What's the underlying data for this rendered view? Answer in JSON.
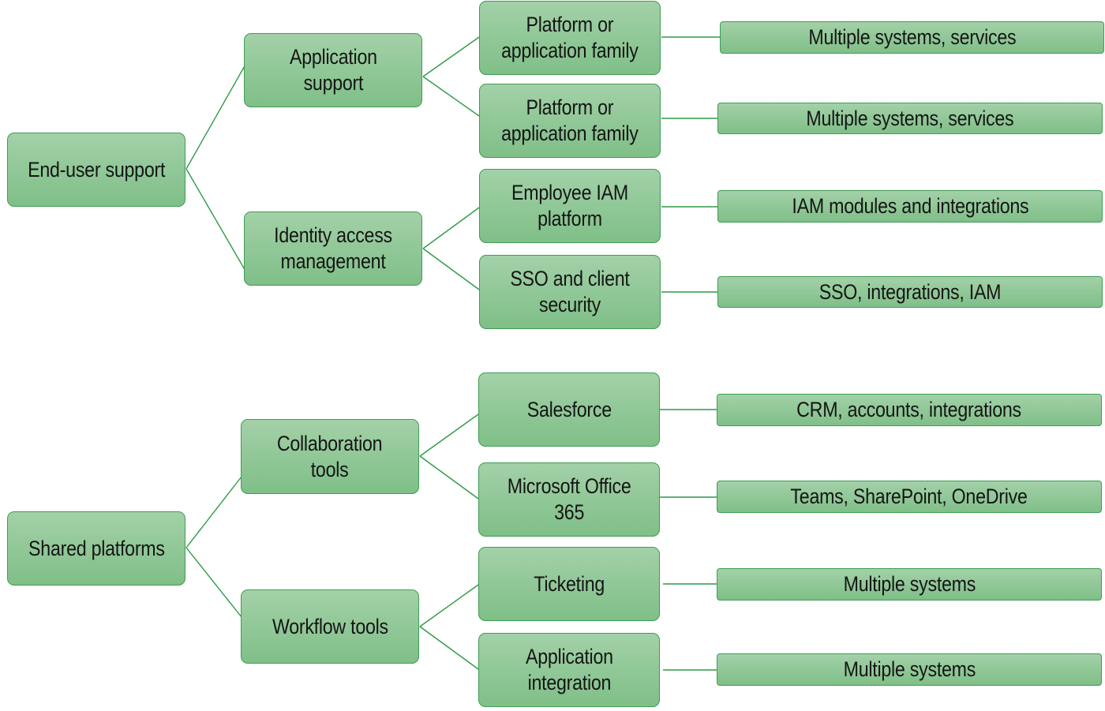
{
  "diagram": {
    "type": "tree",
    "colors": {
      "node_fill": "#93c99a",
      "node_border": "#3f9c55",
      "connector": "#2e9a48",
      "text": "#151515"
    },
    "trees": [
      {
        "root": "End-user support",
        "children": [
          {
            "label": "Application\nsupport",
            "children": [
              {
                "label": "Platform or\napplication family",
                "leaf": "Multiple systems, services"
              },
              {
                "label": "Platform or\napplication family",
                "leaf": "Multiple systems, services"
              }
            ]
          },
          {
            "label": "Identity access\nmanagement",
            "children": [
              {
                "label": "Employee IAM\nplatform",
                "leaf": "IAM modules and integrations"
              },
              {
                "label": "SSO and client\nsecurity",
                "leaf": "SSO, integrations, IAM"
              }
            ]
          }
        ]
      },
      {
        "root": "Shared platforms",
        "children": [
          {
            "label": "Collaboration\ntools",
            "children": [
              {
                "label": "Salesforce",
                "leaf": "CRM, accounts, integrations"
              },
              {
                "label": "Microsoft Office\n365",
                "leaf": "Teams, SharePoint, OneDrive"
              }
            ]
          },
          {
            "label": "Workflow tools",
            "children": [
              {
                "label": "Ticketing",
                "leaf": "Multiple systems"
              },
              {
                "label": "Application\nintegration",
                "leaf": "Multiple systems"
              }
            ]
          }
        ]
      }
    ]
  }
}
